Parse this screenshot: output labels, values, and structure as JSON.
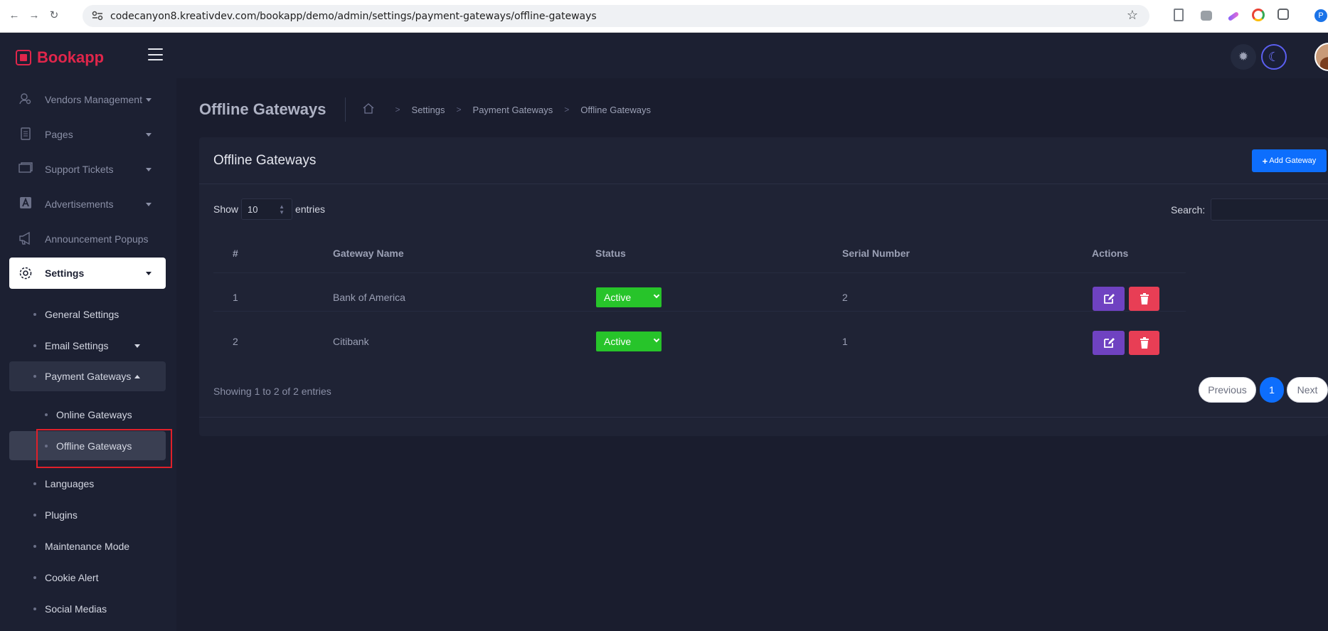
{
  "browser": {
    "url": "codecanyon8.kreativdev.com/bookapp/demo/admin/settings/payment-gateways/offline-gateways",
    "profile_initial": "P"
  },
  "brand": {
    "name": "Bookapp",
    "color": "#e0264b"
  },
  "sidebar": {
    "items": [
      {
        "label": "Vendors Management",
        "icon": "user-search-icon"
      },
      {
        "label": "Pages",
        "icon": "file-icon"
      },
      {
        "label": "Support Tickets",
        "icon": "ticket-icon"
      },
      {
        "label": "Advertisements",
        "icon": "ad-icon"
      },
      {
        "label": "Announcement Popups",
        "icon": "megaphone-icon"
      },
      {
        "label": "Settings",
        "icon": "gear-icon"
      }
    ],
    "settings_sub": [
      {
        "label": "General Settings"
      },
      {
        "label": "Email Settings"
      },
      {
        "label": "Payment Gateways"
      },
      {
        "label": "Online Gateways"
      },
      {
        "label": "Offline Gateways"
      },
      {
        "label": "Languages"
      },
      {
        "label": "Plugins"
      },
      {
        "label": "Maintenance Mode"
      },
      {
        "label": "Cookie Alert"
      },
      {
        "label": "Social Medias"
      }
    ]
  },
  "header": {
    "title": "Offline Gateways",
    "breadcrumb": [
      "Settings",
      "Payment Gateways",
      "Offline Gateways"
    ]
  },
  "card": {
    "title": "Offline Gateways",
    "add_button": "Add Gateway",
    "show_label": "Show",
    "entries_value": "10",
    "entries_label": "entries",
    "search_label": "Search:",
    "columns": [
      "#",
      "Gateway Name",
      "Status",
      "Serial Number",
      "Actions"
    ],
    "rows": [
      {
        "num": "1",
        "name": "Bank of America",
        "status": "Active",
        "serial": "2"
      },
      {
        "num": "2",
        "name": "Citibank",
        "status": "Active",
        "serial": "1"
      }
    ],
    "showing": "Showing 1 to 2 of 2 entries",
    "pagination": {
      "previous": "Previous",
      "page": "1",
      "next": "Next"
    }
  },
  "colors": {
    "accent": "#0d6efd",
    "status_active": "#27c42a",
    "edit": "#6f42c1",
    "delete": "#e83e55"
  }
}
